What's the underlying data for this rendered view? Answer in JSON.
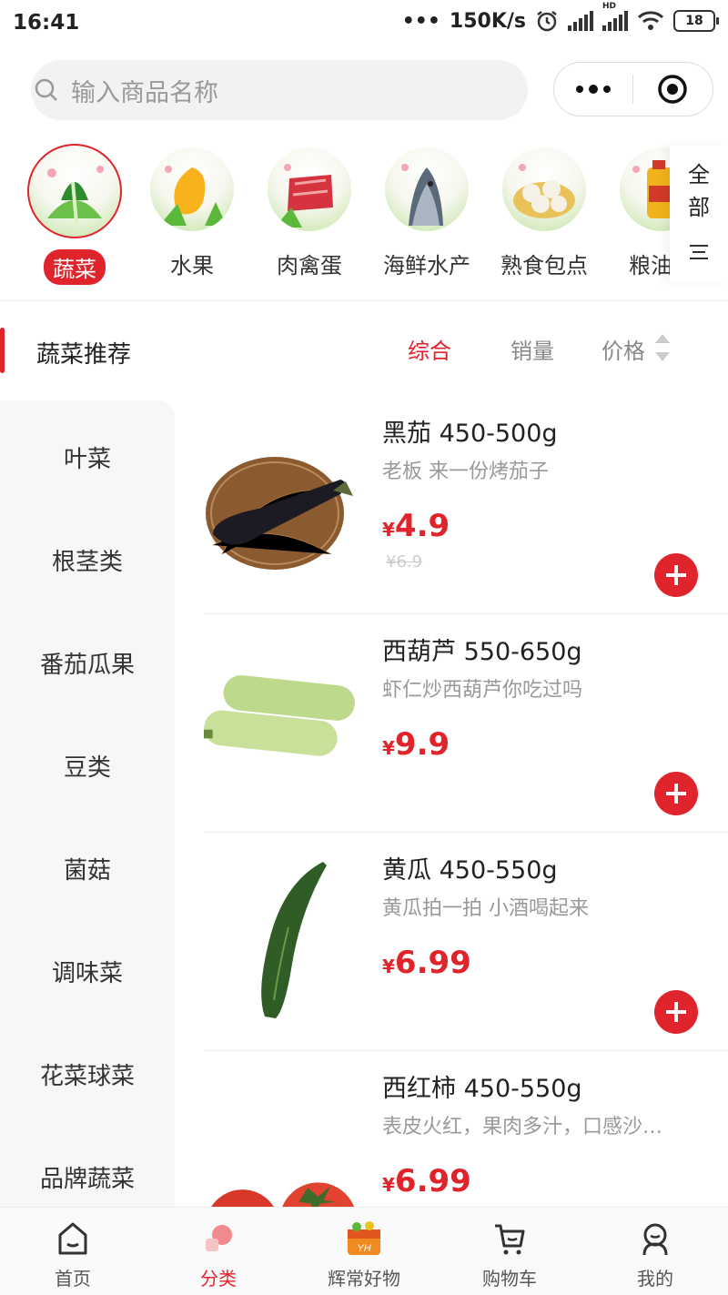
{
  "status_bar": {
    "time": "16:41",
    "network_speed": "150K/s",
    "network_type": "HD",
    "battery": "18"
  },
  "search": {
    "placeholder": "输入商品名称"
  },
  "categories": [
    {
      "label": "蔬菜",
      "active": true
    },
    {
      "label": "水果"
    },
    {
      "label": "肉禽蛋"
    },
    {
      "label": "海鲜水产"
    },
    {
      "label": "熟食包点"
    },
    {
      "label": "粮油调"
    }
  ],
  "all_button": {
    "line1": "全",
    "line2": "部"
  },
  "left_nav": {
    "header": "蔬菜推荐",
    "items": [
      "叶菜",
      "根茎类",
      "番茄瓜果",
      "豆类",
      "菌菇",
      "调味菜",
      "花菜球菜",
      "品牌蔬菜"
    ]
  },
  "sort": {
    "comprehensive": "综合",
    "sales": "销量",
    "price": "价格"
  },
  "products": [
    {
      "name": "黑茄 450-500g",
      "desc": "老板 来一份烤茄子",
      "currency": "¥",
      "price": "4.9",
      "original_price": "¥6.9"
    },
    {
      "name": "西葫芦 550-650g",
      "desc": "虾仁炒西葫芦你吃过吗",
      "currency": "¥",
      "price": "9.9"
    },
    {
      "name": "黄瓜 450-550g",
      "desc": "黄瓜拍一拍 小酒喝起来",
      "currency": "¥",
      "price": "6.99"
    },
    {
      "name": "西红柿 450-550g",
      "desc": "表皮火红，果肉多汁，口感沙…",
      "currency": "¥",
      "price": "6.99"
    }
  ],
  "tabbar": [
    {
      "label": "首页",
      "icon": "home-icon"
    },
    {
      "label": "分类",
      "icon": "category-icon",
      "active": true
    },
    {
      "label": "辉常好物",
      "icon": "yh-gift-icon"
    },
    {
      "label": "购物车",
      "icon": "cart-icon"
    },
    {
      "label": "我的",
      "icon": "profile-icon"
    }
  ],
  "colors": {
    "accent": "#e0242b",
    "muted": "#999999"
  }
}
